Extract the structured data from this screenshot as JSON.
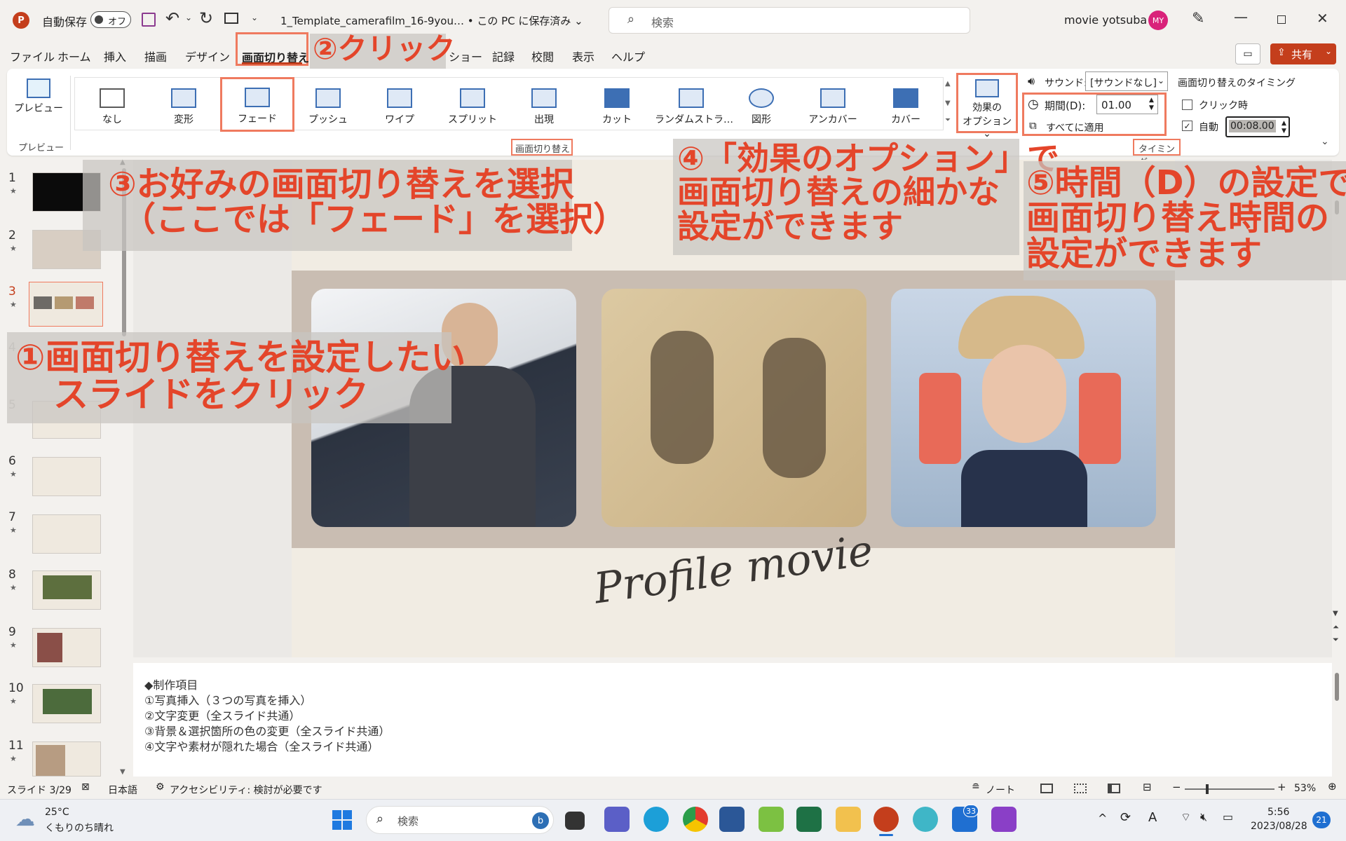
{
  "title_bar": {
    "autosave_label": "自動保存",
    "autosave_toggle": "オフ",
    "file_name": "1_Template_camerafilm_16-9you… • この PC に保存済み ⌄",
    "search_placeholder": "検索",
    "user_name": "movie yotsuba",
    "user_initials": "MY"
  },
  "menu": {
    "file": "ファイル",
    "home": "ホーム",
    "insert": "挿入",
    "draw": "描画",
    "design": "デザイン",
    "transitions": "画面切り替え",
    "slideshow_partial": "ショー",
    "record": "記録",
    "review": "校閲",
    "view": "表示",
    "help": "ヘルプ",
    "share": "共有"
  },
  "ribbon": {
    "preview_button": "プレビュー",
    "preview_group": "プレビュー",
    "transitions": [
      "なし",
      "変形",
      "フェード",
      "プッシュ",
      "ワイプ",
      "スプリット",
      "出現",
      "カット",
      "ランダムストラ…",
      "図形",
      "アンカバー",
      "カバー"
    ],
    "transitions_group": "画面切り替え",
    "effect_options_line1": "効果の",
    "effect_options_line2": "オプション ⌄",
    "sound_label": "サウンド:",
    "sound_value": "[サウンドなし]",
    "duration_label": "期間(D):",
    "duration_value": "01.00",
    "apply_all": "すべてに適用",
    "timing_title": "画面切り替えのタイミング",
    "on_click": "クリック時",
    "auto_label": "自動",
    "auto_value": "00:08.00",
    "timing_group": "タイミング"
  },
  "annotations": {
    "a1_line1": "①画面切り替えを設定したい",
    "a1_line2": "スライドをクリック",
    "a2": "②クリック",
    "a3_line1": "③お好みの画面切り替えを選択",
    "a3_line2": "（ここでは「フェード」を選択）",
    "a4_line1": "④「効果のオプション」で",
    "a4_line2": "画面切り替えの細かな",
    "a4_line3": "設定ができます",
    "a5_line1": "⑤時間（D）の設定で",
    "a5_line2": "画面切り替え時間の",
    "a5_line3": "設定ができます"
  },
  "thumbnails": [
    "1",
    "2",
    "3",
    "4",
    "5",
    "6",
    "7",
    "8",
    "9",
    "10",
    "11"
  ],
  "slide": {
    "script_title": "Profile movie"
  },
  "notes": [
    "◆制作項目",
    "①写真挿入（３つの写真を挿入）",
    "②文字変更（全スライド共通）",
    "③背景＆選択箇所の色の変更（全スライド共通）",
    "④文字や素材が隠れた場合（全スライド共通）"
  ],
  "status_bar": {
    "slide_count": "スライド 3/29",
    "language": "日本語",
    "accessibility": "アクセシビリティ: 検討が必要です",
    "notes_button": "ノート",
    "zoom": "53%"
  },
  "taskbar": {
    "weather_temp": "25°C",
    "weather_desc": "くもりのち晴れ",
    "search": "検索",
    "mail_badge": "33",
    "time": "5:56",
    "date": "2023/08/28",
    "notification_count": "21"
  },
  "colors": {
    "accent": "#c43e1c",
    "highlight": "#ef7a5f",
    "annotation_text": "#e4452a"
  }
}
